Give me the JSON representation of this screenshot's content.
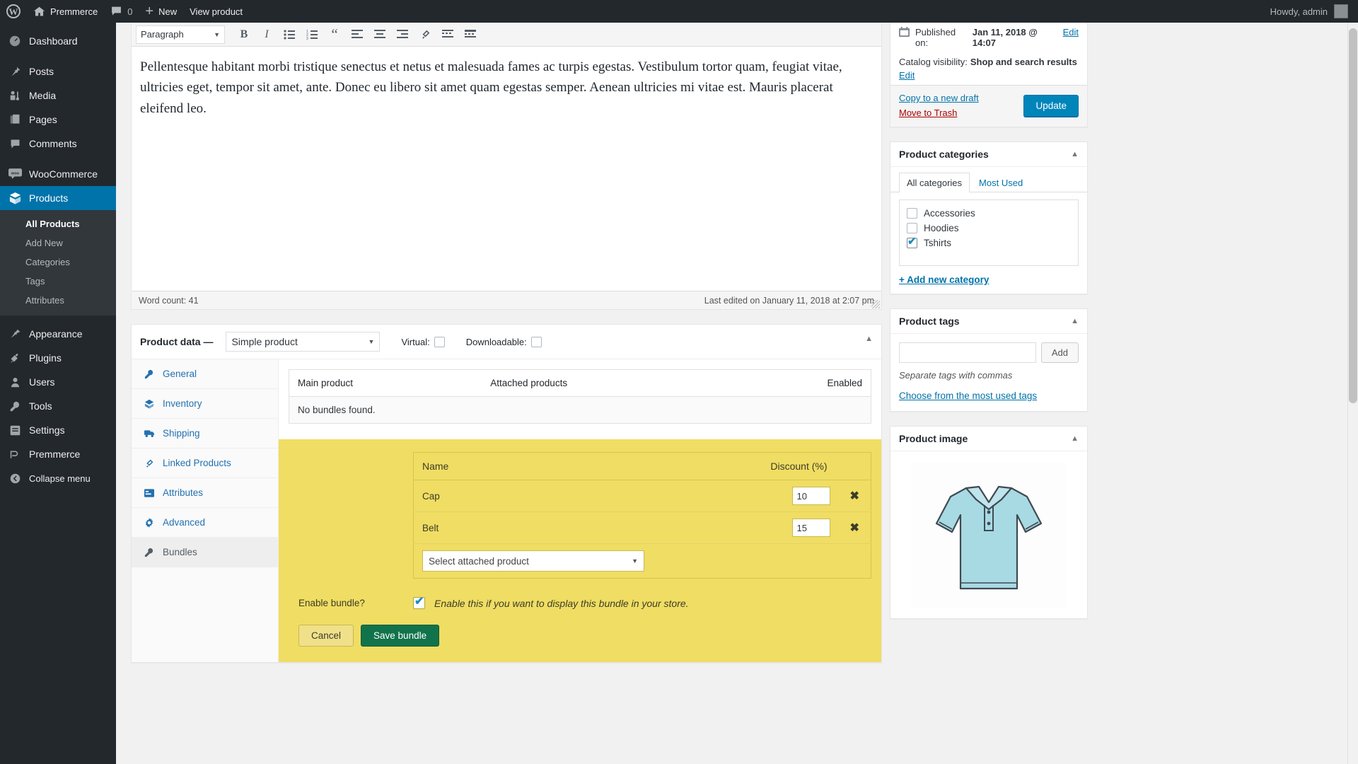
{
  "adminbar": {
    "site_name": "Premmerce",
    "comments_count": "0",
    "new_label": "New",
    "view_product_label": "View product",
    "howdy": "Howdy, admin"
  },
  "sidebar": {
    "items": [
      {
        "label": "Dashboard",
        "icon": "dashboard-icon",
        "current": false
      },
      {
        "label": "Posts",
        "icon": "pin-icon",
        "current": false
      },
      {
        "label": "Media",
        "icon": "media-icon",
        "current": false
      },
      {
        "label": "Pages",
        "icon": "pages-icon",
        "current": false
      },
      {
        "label": "Comments",
        "icon": "comment-icon",
        "current": false
      },
      {
        "label": "WooCommerce",
        "icon": "woo-icon",
        "current": false
      },
      {
        "label": "Products",
        "icon": "products-box-icon",
        "current": true
      },
      {
        "label": "Appearance",
        "icon": "appearance-icon",
        "current": false
      },
      {
        "label": "Plugins",
        "icon": "plugin-icon",
        "current": false
      },
      {
        "label": "Users",
        "icon": "users-icon",
        "current": false
      },
      {
        "label": "Tools",
        "icon": "tools-icon",
        "current": false
      },
      {
        "label": "Settings",
        "icon": "settings-icon",
        "current": false
      },
      {
        "label": "Premmerce",
        "icon": "premmerce-icon",
        "current": false
      },
      {
        "label": "Collapse menu",
        "icon": "collapse-icon",
        "current": false
      }
    ],
    "products_submenu": [
      {
        "label": "All Products",
        "current": true
      },
      {
        "label": "Add New",
        "current": false
      },
      {
        "label": "Categories",
        "current": false
      },
      {
        "label": "Tags",
        "current": false
      },
      {
        "label": "Attributes",
        "current": false
      }
    ]
  },
  "editor": {
    "format_select": "Paragraph",
    "toolbar_buttons": [
      "bold-icon",
      "italic-icon",
      "bulleted-list-icon",
      "numbered-list-icon",
      "blockquote-icon",
      "align-left-icon",
      "align-center-icon",
      "align-right-icon",
      "link-icon",
      "read-more-icon",
      "toolbar-toggle-icon"
    ],
    "content": "Pellentesque habitant morbi tristique senectus et netus et malesuada fames ac turpis egestas. Vestibulum tortor quam, feugiat vitae, ultricies eget, tempor sit amet, ante. Donec eu libero sit amet quam egestas semper. Aenean ultricies mi vitae est. Mauris placerat eleifend leo.",
    "word_count": "Word count: 41",
    "last_edited": "Last edited on January 11, 2018 at 2:07 pm"
  },
  "product_data": {
    "title": "Product data —",
    "type_select": "Simple product",
    "virtual_label": "Virtual:",
    "virtual_checked": false,
    "downloadable_label": "Downloadable:",
    "downloadable_checked": false,
    "tabs": [
      {
        "label": "General",
        "icon": "wrench-icon",
        "active": false
      },
      {
        "label": "Inventory",
        "icon": "inventory-icon",
        "active": false
      },
      {
        "label": "Shipping",
        "icon": "truck-icon",
        "active": false
      },
      {
        "label": "Linked Products",
        "icon": "link-icon",
        "active": false
      },
      {
        "label": "Attributes",
        "icon": "attributes-icon",
        "active": false
      },
      {
        "label": "Advanced",
        "icon": "gear-icon",
        "active": false
      },
      {
        "label": "Bundles",
        "icon": "bundle-wrench-icon",
        "active": true
      }
    ]
  },
  "bundles_panel": {
    "existing_table": {
      "headers": [
        "Main product",
        "Attached products",
        "Enabled"
      ],
      "empty_message": "No bundles found."
    },
    "editor": {
      "headers": [
        "Name",
        "Discount (%)"
      ],
      "rows": [
        {
          "name": "Cap",
          "discount": "10",
          "remove_icon": "remove-x-icon"
        },
        {
          "name": "Belt",
          "discount": "15",
          "remove_icon": "remove-x-icon"
        }
      ],
      "attach_select_placeholder": "Select attached product",
      "enable_label": "Enable bundle?",
      "enable_checked": true,
      "enable_hint": "Enable this if you want to display this bundle in your store.",
      "cancel_label": "Cancel",
      "save_label": "Save bundle"
    }
  },
  "publish_box": {
    "published_label": "Published on:",
    "published_date": "Jan 11, 2018 @ 14:07",
    "edit_date_link": "Edit",
    "catalog_label": "Catalog visibility:",
    "catalog_value": "Shop and search results",
    "catalog_edit_link": "Edit",
    "copy_draft_link": "Copy to a new draft",
    "trash_link": "Move to Trash",
    "update_button": "Update"
  },
  "categories_box": {
    "title": "Product categories",
    "tabs": [
      {
        "label": "All categories",
        "active": true
      },
      {
        "label": "Most Used",
        "active": false
      }
    ],
    "items": [
      {
        "label": "Accessories",
        "checked": false
      },
      {
        "label": "Hoodies",
        "checked": false
      },
      {
        "label": "Tshirts",
        "checked": true
      }
    ],
    "add_new_link": "+ Add new category"
  },
  "tags_box": {
    "title": "Product tags",
    "input_value": "",
    "add_button": "Add",
    "hint": "Separate tags with commas",
    "choose_link": "Choose from the most used tags"
  },
  "image_box": {
    "title": "Product image",
    "image_alt": "polo-shirt-image"
  },
  "colors": {
    "admin_dark": "#23282d",
    "admin_current": "#0073aa",
    "link_blue": "#0073aa",
    "bundle_yellow": "#f0dd63",
    "save_green": "#11734b",
    "update_blue": "#0085ba",
    "trash_red": "#a00000"
  }
}
